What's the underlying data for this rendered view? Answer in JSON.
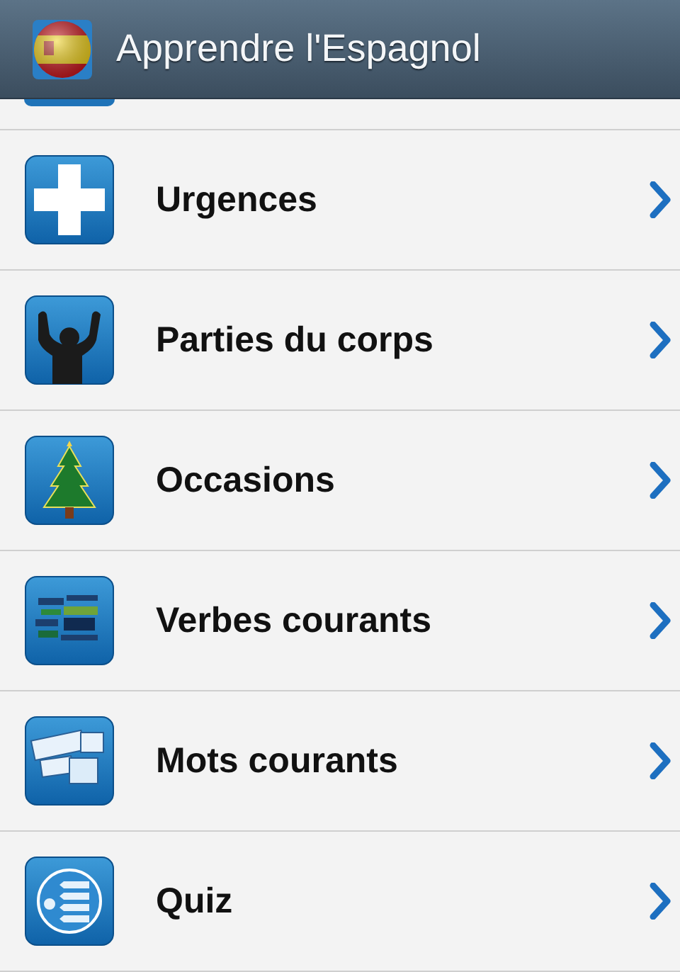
{
  "action_bar": {
    "title": "Apprendre l'Espagnol"
  },
  "categories": [
    {
      "label": "Urgences",
      "kind": "cross"
    },
    {
      "label": "Parties du corps",
      "kind": "person"
    },
    {
      "label": "Occasions",
      "kind": "tree"
    },
    {
      "label": "Verbes courants",
      "kind": "wordcloud"
    },
    {
      "label": "Mots courants",
      "kind": "cards"
    },
    {
      "label": "Quiz",
      "kind": "quiz"
    }
  ]
}
